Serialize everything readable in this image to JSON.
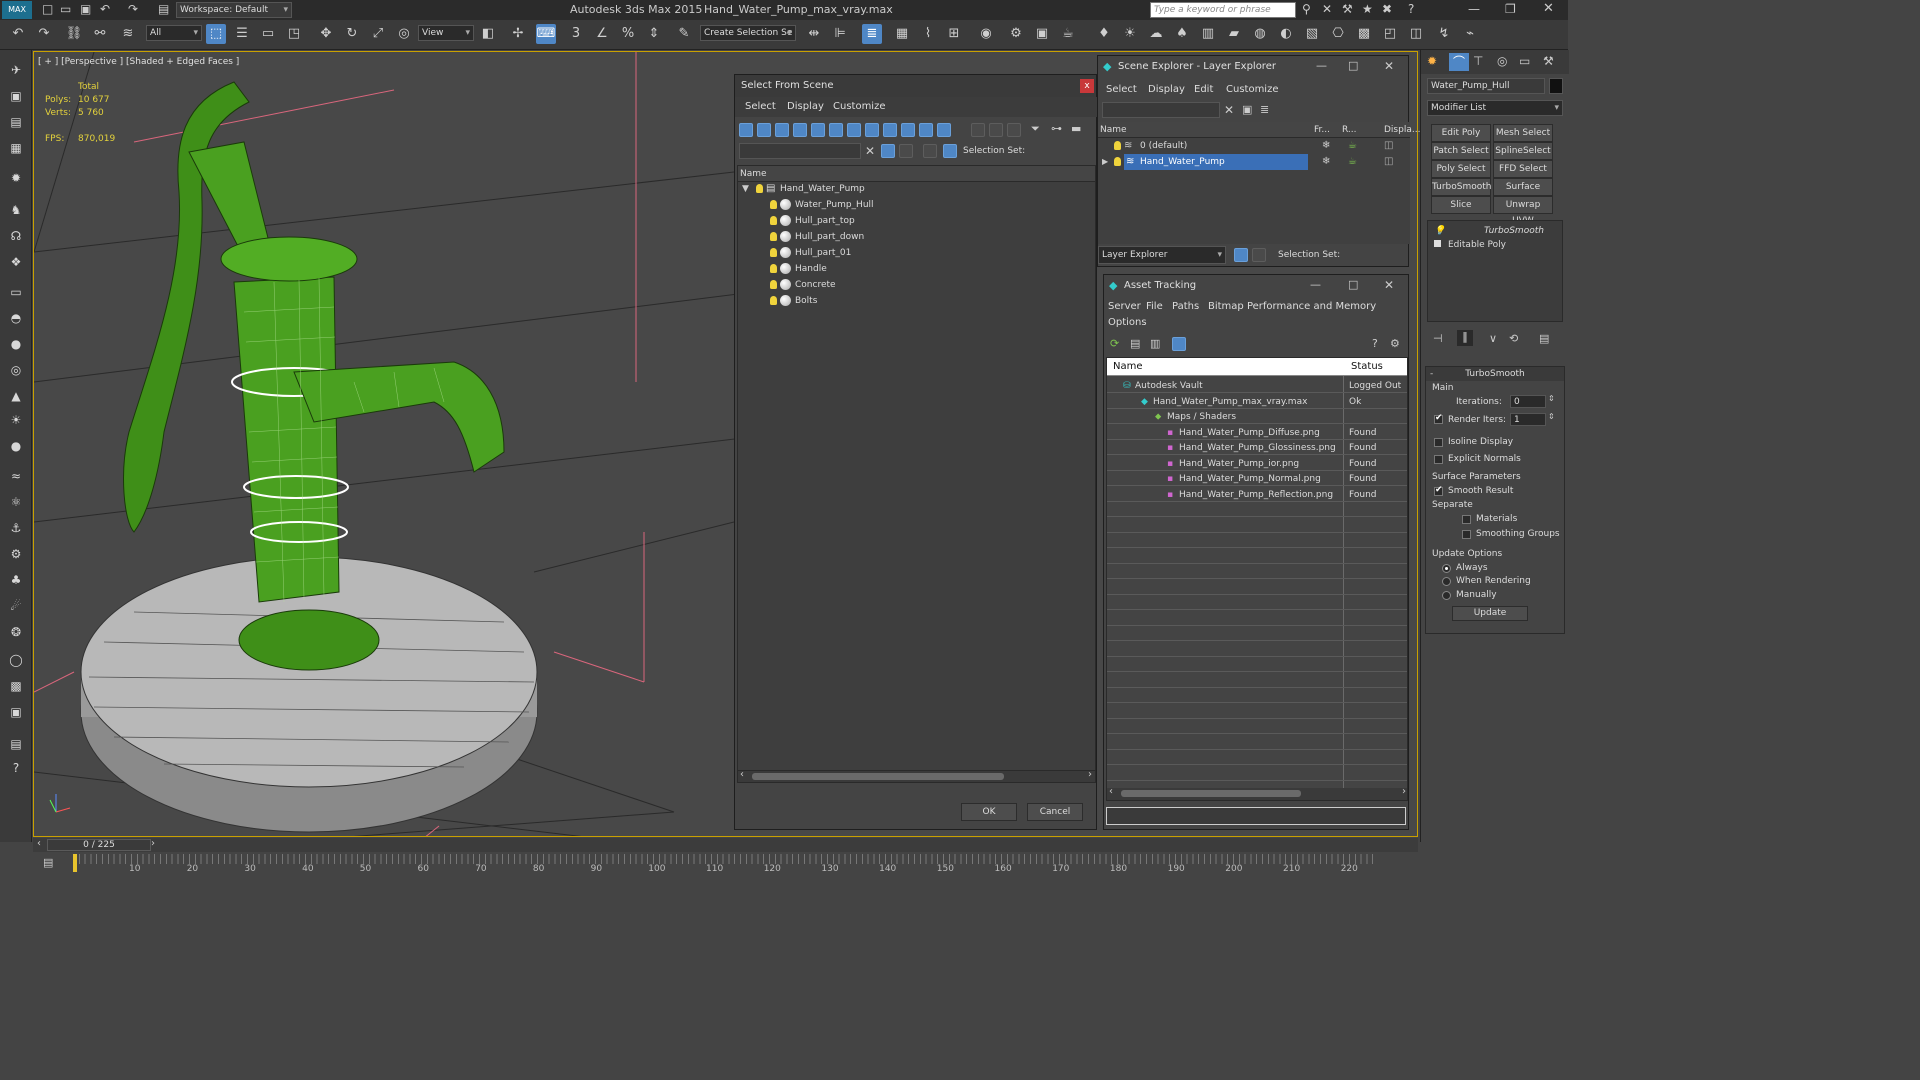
{
  "title": {
    "app": "Autodesk 3ds Max  2015",
    "file": "Hand_Water_Pump_max_vray.max",
    "workspace": "Workspace: Default",
    "search_placeholder": "Type a keyword or phrase"
  },
  "toolbar": {
    "filter": "All",
    "refcoord": "View",
    "selection_set": "Create Selection Se"
  },
  "viewport": {
    "label": "[ + ] [Perspective ] [Shaded + Edged Faces ]",
    "stats_total": "Total",
    "polys_label": "Polys:",
    "polys_value": "10 677",
    "verts_label": "Verts:",
    "verts_value": "5 760",
    "fps_label": "FPS:",
    "fps_value": "870,019"
  },
  "select_dialog": {
    "title": "Select From Scene",
    "menu": [
      "Select",
      "Display",
      "Customize"
    ],
    "selection_set": "Selection Set:",
    "col_name": "Name",
    "items": [
      "Hand_Water_Pump",
      "Water_Pump_Hull",
      "Hull_part_top",
      "Hull_part_down",
      "Hull_part_01",
      "Handle",
      "Concrete",
      "Bolts"
    ],
    "ok": "OK",
    "cancel": "Cancel"
  },
  "scene_explorer": {
    "title": "Scene Explorer - Layer Explorer",
    "menu": [
      "Select",
      "Display",
      "Edit",
      "Customize"
    ],
    "cols": [
      "Name",
      "Fr...",
      "R...",
      "Displa..."
    ],
    "layers": [
      "0 (default)",
      "Hand_Water_Pump"
    ],
    "footer": "Layer Explorer",
    "selection_set": "Selection Set:"
  },
  "asset_tracking": {
    "title": "Asset Tracking",
    "menu": [
      "Server",
      "File",
      "Paths",
      "Bitmap Performance and Memory",
      "Options"
    ],
    "cols": [
      "Name",
      "Status"
    ],
    "rows": [
      {
        "name": "Autodesk Vault",
        "status": "Logged Out"
      },
      {
        "name": "Hand_Water_Pump_max_vray.max",
        "status": "Ok"
      },
      {
        "name": "Maps / Shaders",
        "status": ""
      },
      {
        "name": "Hand_Water_Pump_Diffuse.png",
        "status": "Found"
      },
      {
        "name": "Hand_Water_Pump_Glossiness.png",
        "status": "Found"
      },
      {
        "name": "Hand_Water_Pump_ior.png",
        "status": "Found"
      },
      {
        "name": "Hand_Water_Pump_Normal.png",
        "status": "Found"
      },
      {
        "name": "Hand_Water_Pump_Reflection.png",
        "status": "Found"
      }
    ]
  },
  "command_panel": {
    "object_name": "Water_Pump_Hull",
    "modifier_list": "Modifier List",
    "buttons": [
      "Edit Poly",
      "Mesh Select",
      "Patch Select",
      "SplineSelect",
      "Poly Select",
      "FFD Select",
      "TurboSmooth",
      "Surface Select",
      "Slice",
      "Unwrap UVW"
    ],
    "stack": [
      "TurboSmooth",
      "Editable Poly"
    ],
    "rollout": "TurboSmooth",
    "main": "Main",
    "iterations_label": "Iterations:",
    "iterations": "0",
    "render_iters_label": "Render Iters:",
    "render_iters": "1",
    "isoline": "Isoline Display",
    "explicit": "Explicit Normals",
    "surface_params": "Surface Parameters",
    "smooth_result": "Smooth Result",
    "separate": "Separate",
    "materials": "Materials",
    "smoothing_groups": "Smoothing Groups",
    "update_options": "Update Options",
    "always": "Always",
    "when_rendering": "When Rendering",
    "manually": "Manually",
    "update": "Update"
  },
  "timeline": {
    "frame": "0 / 225",
    "ticks": [
      "10",
      "20",
      "30",
      "40",
      "50",
      "60",
      "70",
      "80",
      "90",
      "100",
      "110",
      "120",
      "130",
      "140",
      "150",
      "160",
      "170",
      "180",
      "190",
      "200",
      "210",
      "220"
    ]
  }
}
